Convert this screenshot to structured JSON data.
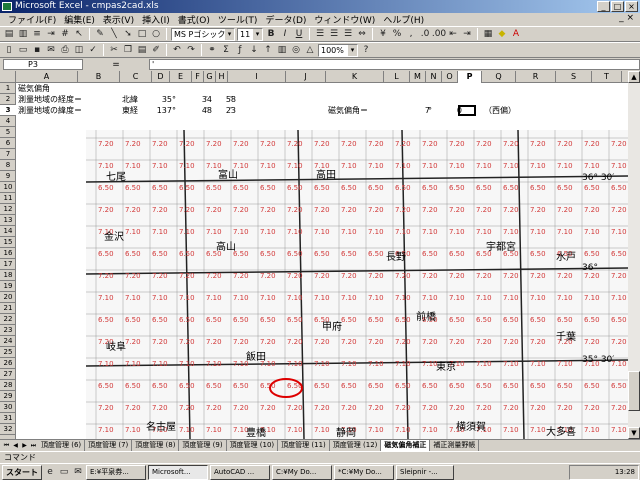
{
  "window": {
    "title": "Microsoft Excel - cmpas2cad.xls",
    "minimize": "_",
    "maximize": "□",
    "close": "×"
  },
  "menu": [
    "ファイル(F)",
    "編集(E)",
    "表示(V)",
    "挿入(I)",
    "書式(O)",
    "ツール(T)",
    "データ(D)",
    "ウィンドウ(W)",
    "ヘルプ(H)"
  ],
  "menu_close": "_ ×",
  "toolbar": {
    "font_name": "MS Pゴシック",
    "font_size": "11",
    "zoom": "100%",
    "bold": "B",
    "italic": "I",
    "underline": "U"
  },
  "formula_bar": {
    "cell_ref": "P3",
    "fx": "=",
    "content": "'"
  },
  "columns": [
    "A",
    "B",
    "C",
    "D",
    "E",
    "F",
    "G",
    "H",
    "I",
    "J",
    "K",
    "L",
    "M",
    "N",
    "O",
    "P",
    "Q",
    "R",
    "S",
    "T",
    "U",
    "V"
  ],
  "rows": [
    "1",
    "2",
    "3",
    "4",
    "5",
    "6",
    "7",
    "8",
    "9",
    "10",
    "11",
    "12",
    "13",
    "14",
    "15",
    "16",
    "17",
    "18",
    "19",
    "20",
    "21",
    "22",
    "23",
    "24",
    "25",
    "26",
    "27",
    "28",
    "29",
    "30",
    "31",
    "32"
  ],
  "cells": {
    "a1": "磁気偏角",
    "a2": "測量地域の経度＝",
    "a3": "測量地域の緯度＝",
    "c2": "北緯",
    "c3": "東経",
    "d2": "35",
    "d3": "137",
    "e2": "°",
    "e3": "°",
    "f2": "34",
    "f3": "48",
    "g2": "′",
    "g3": "′",
    "h2": "58",
    "h3": "23",
    "i2": "″",
    "i3": "″",
    "k3": "磁気偏角＝",
    "m3": "7",
    "n3": "°",
    "o3": "0",
    "p3": "",
    "q3": "（西偏）"
  },
  "map": {
    "latitudes": [
      "36° 30′",
      "36°",
      "35° 30′"
    ],
    "city_labels": [
      "七尾",
      "富山",
      "高田",
      "長野",
      "宇都宮",
      "水戸",
      "金沢",
      "高山",
      "前橋",
      "千葉",
      "岐阜",
      "飯田",
      "甲府",
      "東京",
      "名古屋",
      "豊橋",
      "静岡",
      "横須賀",
      "大多喜"
    ]
  },
  "sheet_tabs": [
    "頂度管理 (6)",
    "頂度管理 (7)",
    "頂度管理 (8)",
    "頂度管理 (9)",
    "頂度管理 (10)",
    "頂度管理 (11)",
    "頂度管理 (12)",
    "磁気偏角補正",
    "補正測量野帳"
  ],
  "status": "コマンド",
  "taskbar": {
    "start": "スタート",
    "tasks": [
      "E:¥平泉券...",
      "Microsoft...",
      "AutoCAD ...",
      "C:¥My Do...",
      "*C:¥My Do...",
      "Sleipnir -..."
    ],
    "clock": "13:28"
  },
  "colors": {
    "title_start": "#0a246a",
    "title_end": "#a6caf0",
    "map_red": "#d23a3a"
  }
}
